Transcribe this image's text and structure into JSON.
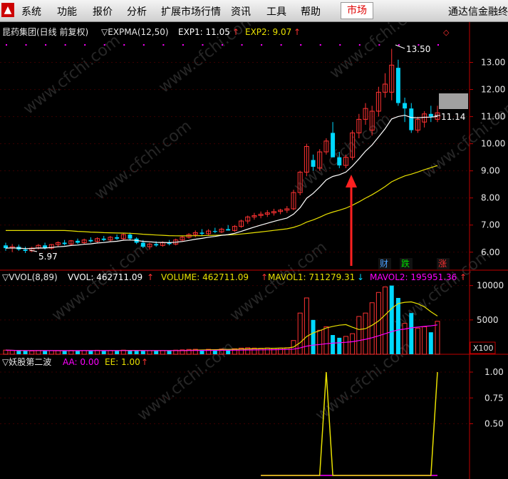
{
  "menu": {
    "items": [
      "系统",
      "功能",
      "报价",
      "分析",
      "扩展市场行情",
      "资讯",
      "工具",
      "帮助"
    ],
    "active": "市场",
    "brand": "通达信金融终"
  },
  "main_panel": {
    "header_name": "昆药集团(日线 前复权)",
    "header_indicator": "▽EXPMA(12,50)",
    "exp1_label": "EXP1: 11.05",
    "exp2_label": "EXP2: 9.07",
    "arrow_mark": "↑",
    "high_label": "13.50",
    "low_label": "5.97",
    "last_label": "11.14",
    "marker_cai": "财",
    "marker_die": "跌",
    "marker_zhang": "涨",
    "y_ticks": [
      "13.00",
      "12.00",
      "11.00",
      "10.00",
      "9.00",
      "8.00",
      "7.00",
      "6.00"
    ],
    "colors": {
      "up": "#ff3232",
      "down": "#00d8ff",
      "exp1": "#ffffff",
      "exp2": "#e8e000",
      "axis": "#c00000"
    }
  },
  "volume_panel": {
    "header_name": "▽VVOL(8,89)",
    "vvol_label": "VVOL: 462711.09",
    "volume_label": "VOLUME: 462711.09",
    "mavol1_label": "MAVOL1: 711279.31",
    "mavol2_label": "MAVOL2: 195951.36",
    "down_mark": "↓",
    "y_ticks": [
      "10000",
      "5000"
    ],
    "unit": "X100",
    "colors": {
      "mavol1": "#e8e000",
      "mavol2": "#ff00ff"
    }
  },
  "signal_panel": {
    "header_name": "▽妖股第二波",
    "aa_label": "AA: 0.00",
    "ee_label": "EE: 1.00",
    "y_ticks": [
      "1.00",
      "0.75",
      "0.50"
    ],
    "colors": {
      "ee": "#e8e000",
      "aa": "#ff00ff"
    }
  },
  "watermark": "www.cfchi.com",
  "chart_data": {
    "type": "candlestick",
    "price_range": [
      5.6,
      13.75
    ],
    "volume_range": [
      0,
      11000
    ],
    "signal_range": [
      0,
      1
    ],
    "candles": [
      {
        "o": 6.25,
        "h": 6.35,
        "l": 6.05,
        "c": 6.15
      },
      {
        "o": 6.15,
        "h": 6.3,
        "l": 6.0,
        "c": 6.2
      },
      {
        "o": 6.2,
        "h": 6.28,
        "l": 6.05,
        "c": 6.1
      },
      {
        "o": 6.1,
        "h": 6.2,
        "l": 5.97,
        "c": 6.05
      },
      {
        "o": 6.05,
        "h": 6.2,
        "l": 6.0,
        "c": 6.15
      },
      {
        "o": 6.15,
        "h": 6.3,
        "l": 6.1,
        "c": 6.25
      },
      {
        "o": 6.25,
        "h": 6.35,
        "l": 6.1,
        "c": 6.15
      },
      {
        "o": 6.15,
        "h": 6.3,
        "l": 6.1,
        "c": 6.28
      },
      {
        "o": 6.28,
        "h": 6.4,
        "l": 6.2,
        "c": 6.35
      },
      {
        "o": 6.35,
        "h": 6.45,
        "l": 6.25,
        "c": 6.3
      },
      {
        "o": 6.3,
        "h": 6.45,
        "l": 6.25,
        "c": 6.42
      },
      {
        "o": 6.42,
        "h": 6.5,
        "l": 6.3,
        "c": 6.35
      },
      {
        "o": 6.35,
        "h": 6.5,
        "l": 6.3,
        "c": 6.45
      },
      {
        "o": 6.45,
        "h": 6.55,
        "l": 6.35,
        "c": 6.4
      },
      {
        "o": 6.4,
        "h": 6.55,
        "l": 6.35,
        "c": 6.5
      },
      {
        "o": 6.5,
        "h": 6.6,
        "l": 6.4,
        "c": 6.45
      },
      {
        "o": 6.45,
        "h": 6.6,
        "l": 6.4,
        "c": 6.55
      },
      {
        "o": 6.55,
        "h": 6.65,
        "l": 6.45,
        "c": 6.5
      },
      {
        "o": 6.5,
        "h": 6.7,
        "l": 6.45,
        "c": 6.65
      },
      {
        "o": 6.65,
        "h": 6.72,
        "l": 6.45,
        "c": 6.5
      },
      {
        "o": 6.5,
        "h": 6.55,
        "l": 6.3,
        "c": 6.35
      },
      {
        "o": 6.35,
        "h": 6.45,
        "l": 6.15,
        "c": 6.2
      },
      {
        "o": 6.2,
        "h": 6.35,
        "l": 6.1,
        "c": 6.3
      },
      {
        "o": 6.3,
        "h": 6.4,
        "l": 6.2,
        "c": 6.25
      },
      {
        "o": 6.25,
        "h": 6.4,
        "l": 6.2,
        "c": 6.35
      },
      {
        "o": 6.35,
        "h": 6.45,
        "l": 6.25,
        "c": 6.3
      },
      {
        "o": 6.3,
        "h": 6.5,
        "l": 6.25,
        "c": 6.45
      },
      {
        "o": 6.45,
        "h": 6.6,
        "l": 6.4,
        "c": 6.55
      },
      {
        "o": 6.55,
        "h": 6.7,
        "l": 6.5,
        "c": 6.65
      },
      {
        "o": 6.65,
        "h": 6.8,
        "l": 6.55,
        "c": 6.72
      },
      {
        "o": 6.72,
        "h": 6.85,
        "l": 6.6,
        "c": 6.68
      },
      {
        "o": 6.68,
        "h": 6.85,
        "l": 6.6,
        "c": 6.78
      },
      {
        "o": 6.78,
        "h": 6.9,
        "l": 6.7,
        "c": 6.75
      },
      {
        "o": 6.75,
        "h": 6.9,
        "l": 6.7,
        "c": 6.85
      },
      {
        "o": 6.85,
        "h": 7.0,
        "l": 6.8,
        "c": 6.8
      },
      {
        "o": 6.8,
        "h": 7.0,
        "l": 6.75,
        "c": 6.95
      },
      {
        "o": 6.95,
        "h": 7.2,
        "l": 6.9,
        "c": 7.15
      },
      {
        "o": 7.15,
        "h": 7.35,
        "l": 7.05,
        "c": 7.3
      },
      {
        "o": 7.3,
        "h": 7.45,
        "l": 7.2,
        "c": 7.35
      },
      {
        "o": 7.35,
        "h": 7.5,
        "l": 7.25,
        "c": 7.4
      },
      {
        "o": 7.4,
        "h": 7.55,
        "l": 7.3,
        "c": 7.45
      },
      {
        "o": 7.45,
        "h": 7.6,
        "l": 7.35,
        "c": 7.5
      },
      {
        "o": 7.5,
        "h": 7.6,
        "l": 7.4,
        "c": 7.55
      },
      {
        "o": 7.55,
        "h": 7.7,
        "l": 7.45,
        "c": 7.6
      },
      {
        "o": 7.6,
        "h": 8.3,
        "l": 7.55,
        "c": 8.2
      },
      {
        "o": 8.2,
        "h": 9.0,
        "l": 8.1,
        "c": 8.95
      },
      {
        "o": 8.95,
        "h": 10.0,
        "l": 8.8,
        "c": 9.9
      },
      {
        "o": 9.4,
        "h": 9.6,
        "l": 9.0,
        "c": 9.15
      },
      {
        "o": 9.1,
        "h": 9.8,
        "l": 9.0,
        "c": 9.7
      },
      {
        "o": 9.7,
        "h": 10.2,
        "l": 9.6,
        "c": 10.1
      },
      {
        "o": 10.4,
        "h": 10.8,
        "l": 10.0,
        "c": 9.5
      },
      {
        "o": 9.5,
        "h": 9.7,
        "l": 9.1,
        "c": 9.2
      },
      {
        "o": 9.2,
        "h": 9.6,
        "l": 9.1,
        "c": 9.5
      },
      {
        "o": 9.5,
        "h": 10.5,
        "l": 9.4,
        "c": 10.4
      },
      {
        "o": 10.4,
        "h": 11.1,
        "l": 10.2,
        "c": 10.9
      },
      {
        "o": 10.9,
        "h": 11.5,
        "l": 10.7,
        "c": 11.3
      },
      {
        "o": 10.5,
        "h": 11.4,
        "l": 10.3,
        "c": 11.2
      },
      {
        "o": 11.2,
        "h": 12.1,
        "l": 11.0,
        "c": 11.9
      },
      {
        "o": 11.9,
        "h": 12.6,
        "l": 11.7,
        "c": 12.2
      },
      {
        "o": 11.9,
        "h": 13.5,
        "l": 11.6,
        "c": 12.9
      },
      {
        "o": 12.8,
        "h": 13.1,
        "l": 11.4,
        "c": 11.5
      },
      {
        "o": 11.5,
        "h": 11.7,
        "l": 10.8,
        "c": 11.3
      },
      {
        "o": 11.3,
        "h": 11.5,
        "l": 10.4,
        "c": 10.5
      },
      {
        "o": 10.5,
        "h": 11.0,
        "l": 10.4,
        "c": 10.9
      },
      {
        "o": 10.8,
        "h": 11.2,
        "l": 10.6,
        "c": 11.1
      },
      {
        "o": 11.1,
        "h": 11.4,
        "l": 10.8,
        "c": 11.0
      },
      {
        "o": 10.9,
        "h": 11.4,
        "l": 10.8,
        "c": 11.14
      }
    ],
    "volume": [
      600,
      550,
      500,
      520,
      480,
      560,
      500,
      520,
      540,
      500,
      560,
      530,
      520,
      540,
      580,
      520,
      560,
      540,
      600,
      620,
      500,
      480,
      520,
      500,
      540,
      560,
      600,
      640,
      700,
      720,
      680,
      720,
      700,
      760,
      740,
      800,
      900,
      950,
      900,
      880,
      920,
      860,
      900,
      950,
      2000,
      6000,
      8200,
      5000,
      3500,
      4000,
      2800,
      2400,
      2600,
      3000,
      5500,
      6000,
      7500,
      9000,
      9800,
      10000,
      8200,
      4500,
      6000,
      3800,
      4000,
      3200,
      4800
    ],
    "down_days": [
      2,
      3,
      6,
      9,
      11,
      13,
      15,
      17,
      19,
      20,
      21,
      23,
      25,
      30,
      32,
      34,
      47,
      50,
      51,
      59,
      60,
      62,
      65
    ],
    "signal_ee": [
      0,
      0,
      0,
      0,
      0,
      0,
      0,
      0,
      0,
      0,
      0,
      0,
      0,
      0,
      0,
      0,
      0,
      0,
      0,
      0,
      0,
      0,
      0,
      0,
      0,
      0,
      0,
      0,
      0,
      0,
      0,
      0,
      0,
      0,
      0,
      0,
      0,
      0,
      0,
      0,
      0,
      0,
      0,
      0,
      0,
      0,
      0,
      0,
      0,
      1,
      0,
      0,
      0,
      0,
      0,
      0,
      0,
      0,
      0,
      0,
      0,
      0,
      0,
      0,
      0,
      0,
      1
    ],
    "signal_aa": 0
  }
}
